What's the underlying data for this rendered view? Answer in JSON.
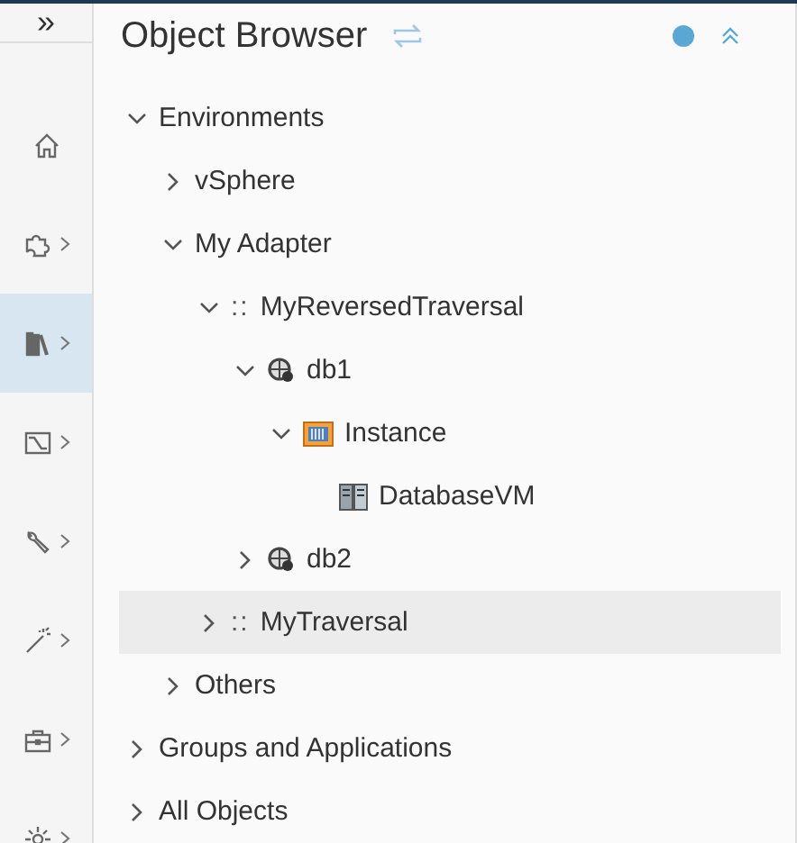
{
  "sidebar": {
    "toggle": "»",
    "items": [
      {
        "kind": "home",
        "chevron": false,
        "selected": false
      },
      {
        "kind": "plugin",
        "chevron": true,
        "selected": false
      },
      {
        "kind": "library",
        "chevron": true,
        "selected": true
      },
      {
        "kind": "chart",
        "chevron": true,
        "selected": false
      },
      {
        "kind": "wrench",
        "chevron": true,
        "selected": false
      },
      {
        "kind": "wand",
        "chevron": true,
        "selected": false
      },
      {
        "kind": "toolbox",
        "chevron": true,
        "selected": false
      },
      {
        "kind": "gear",
        "chevron": true,
        "selected": false
      }
    ]
  },
  "header": {
    "title": "Object Browser"
  },
  "tree": [
    {
      "label": "Environments",
      "expanded": true,
      "selected": false,
      "children": [
        {
          "label": "vSphere",
          "expanded": false,
          "selected": false
        },
        {
          "label": "My Adapter",
          "expanded": true,
          "selected": false,
          "children": [
            {
              "label": "MyReversedTraversal",
              "prefix": "::",
              "expanded": true,
              "selected": false,
              "children": [
                {
                  "label": "db1",
                  "kind": "db",
                  "expanded": true,
                  "selected": false,
                  "children": [
                    {
                      "label": "Instance",
                      "kind": "instance",
                      "expanded": true,
                      "selected": false,
                      "children": [
                        {
                          "label": "DatabaseVM",
                          "kind": "vm",
                          "selected": false
                        }
                      ]
                    }
                  ]
                },
                {
                  "label": "db2",
                  "kind": "db",
                  "expanded": false,
                  "selected": false
                }
              ]
            },
            {
              "label": "MyTraversal",
              "prefix": "::",
              "expanded": false,
              "selected": true
            }
          ]
        },
        {
          "label": "Others",
          "expanded": false,
          "selected": false
        }
      ]
    },
    {
      "label": "Groups and Applications",
      "expanded": false,
      "selected": false
    },
    {
      "label": "All Objects",
      "expanded": false,
      "selected": false
    }
  ]
}
